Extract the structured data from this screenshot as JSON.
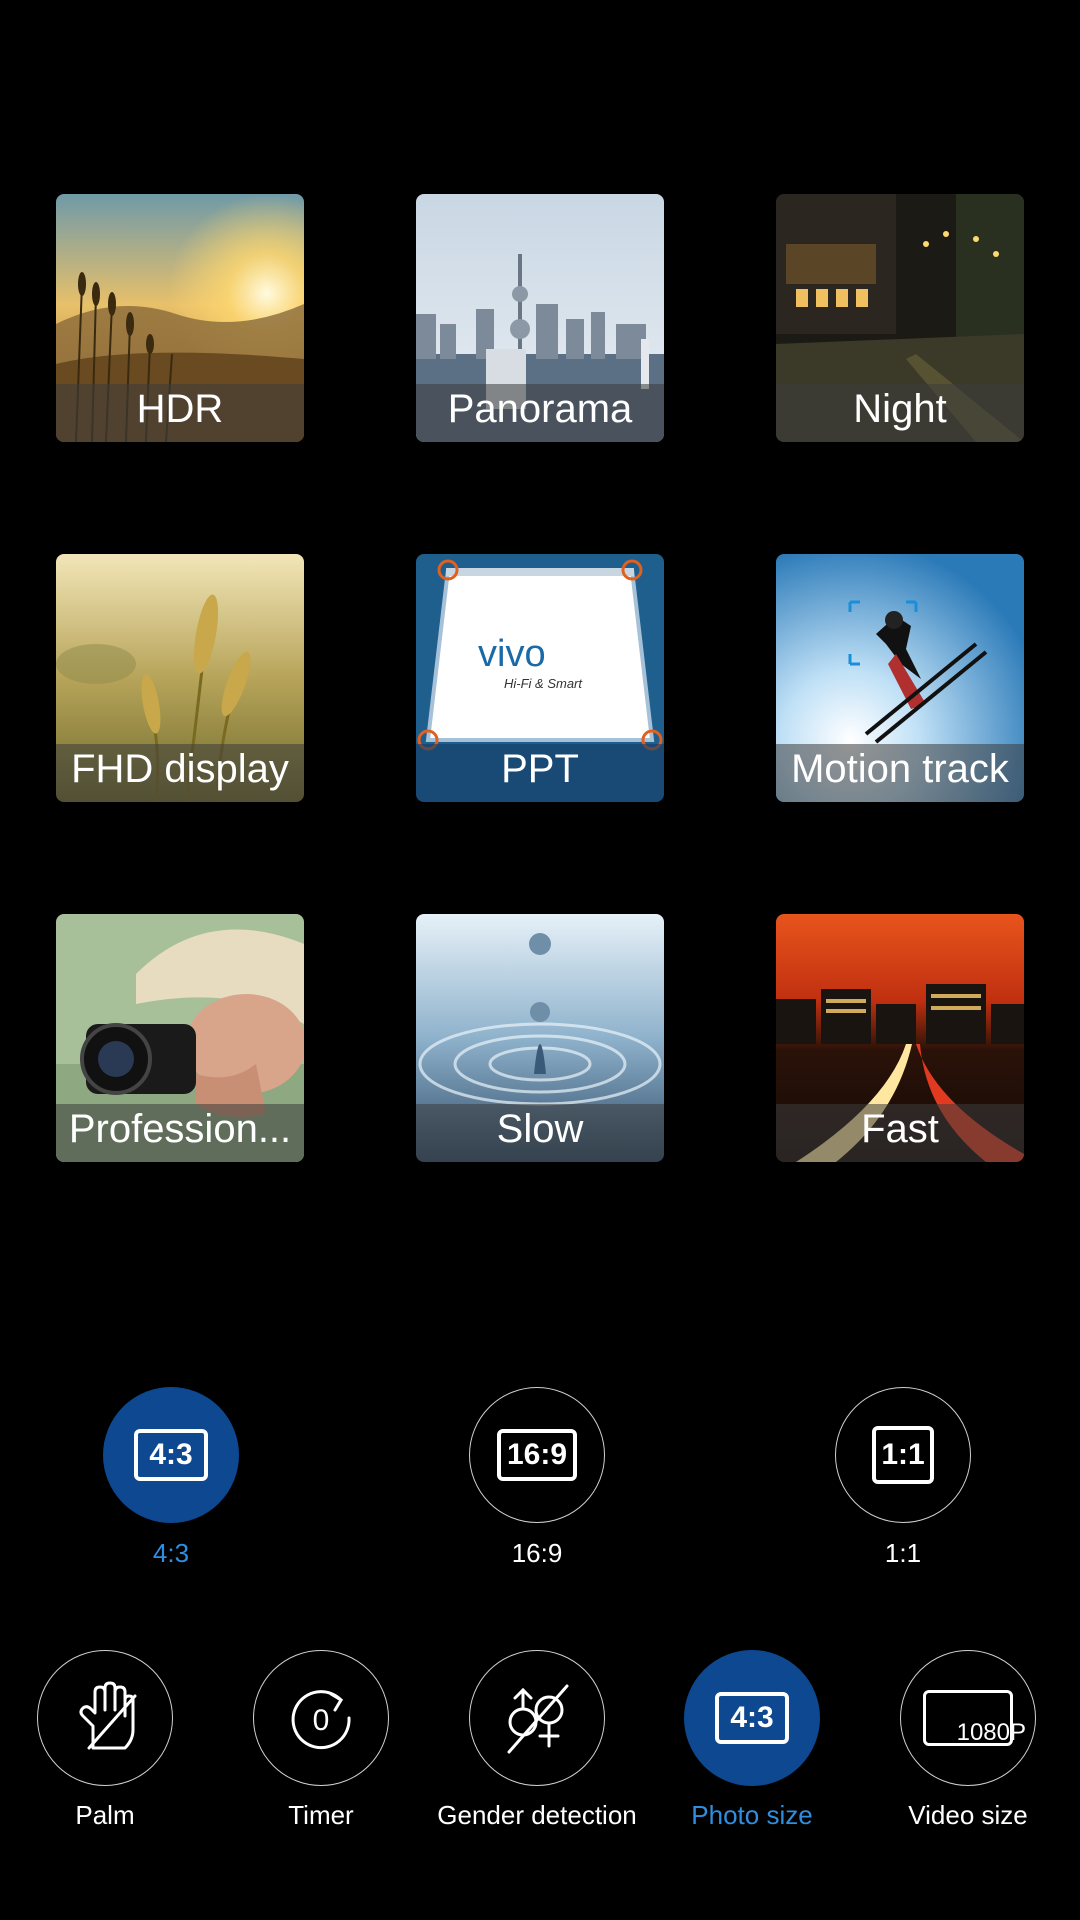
{
  "modes": [
    {
      "label": "HDR"
    },
    {
      "label": "Panorama"
    },
    {
      "label": "Night"
    },
    {
      "label": "FHD display"
    },
    {
      "label": "PPT",
      "logo_text": "vivo",
      "logo_sub": "Hi-Fi & Smart"
    },
    {
      "label": "Motion track"
    },
    {
      "label": "Profession..."
    },
    {
      "label": "Slow"
    },
    {
      "label": "Fast"
    }
  ],
  "ratios": [
    {
      "icon_text": "4:3",
      "label": "4:3",
      "selected": true
    },
    {
      "icon_text": "16:9",
      "label": "16:9",
      "selected": false
    },
    {
      "icon_text": "1:1",
      "label": "1:1",
      "selected": false
    }
  ],
  "tools": [
    {
      "label": "Palm",
      "icon": "palm-icon",
      "selected": false
    },
    {
      "label": "Timer",
      "icon": "timer-icon",
      "icon_text": "0",
      "selected": false
    },
    {
      "label": "Gender detection",
      "icon": "gender-detection-icon",
      "selected": false
    },
    {
      "label": "Photo size",
      "icon": "photo-size-icon",
      "icon_text": "4:3",
      "selected": true
    },
    {
      "label": "Video size",
      "icon": "video-size-icon",
      "icon_text": "1080P",
      "selected": false
    }
  ],
  "colors": {
    "background": "#000000",
    "selected_fill": "#0d4891",
    "selected_text": "#2f8ee0"
  }
}
